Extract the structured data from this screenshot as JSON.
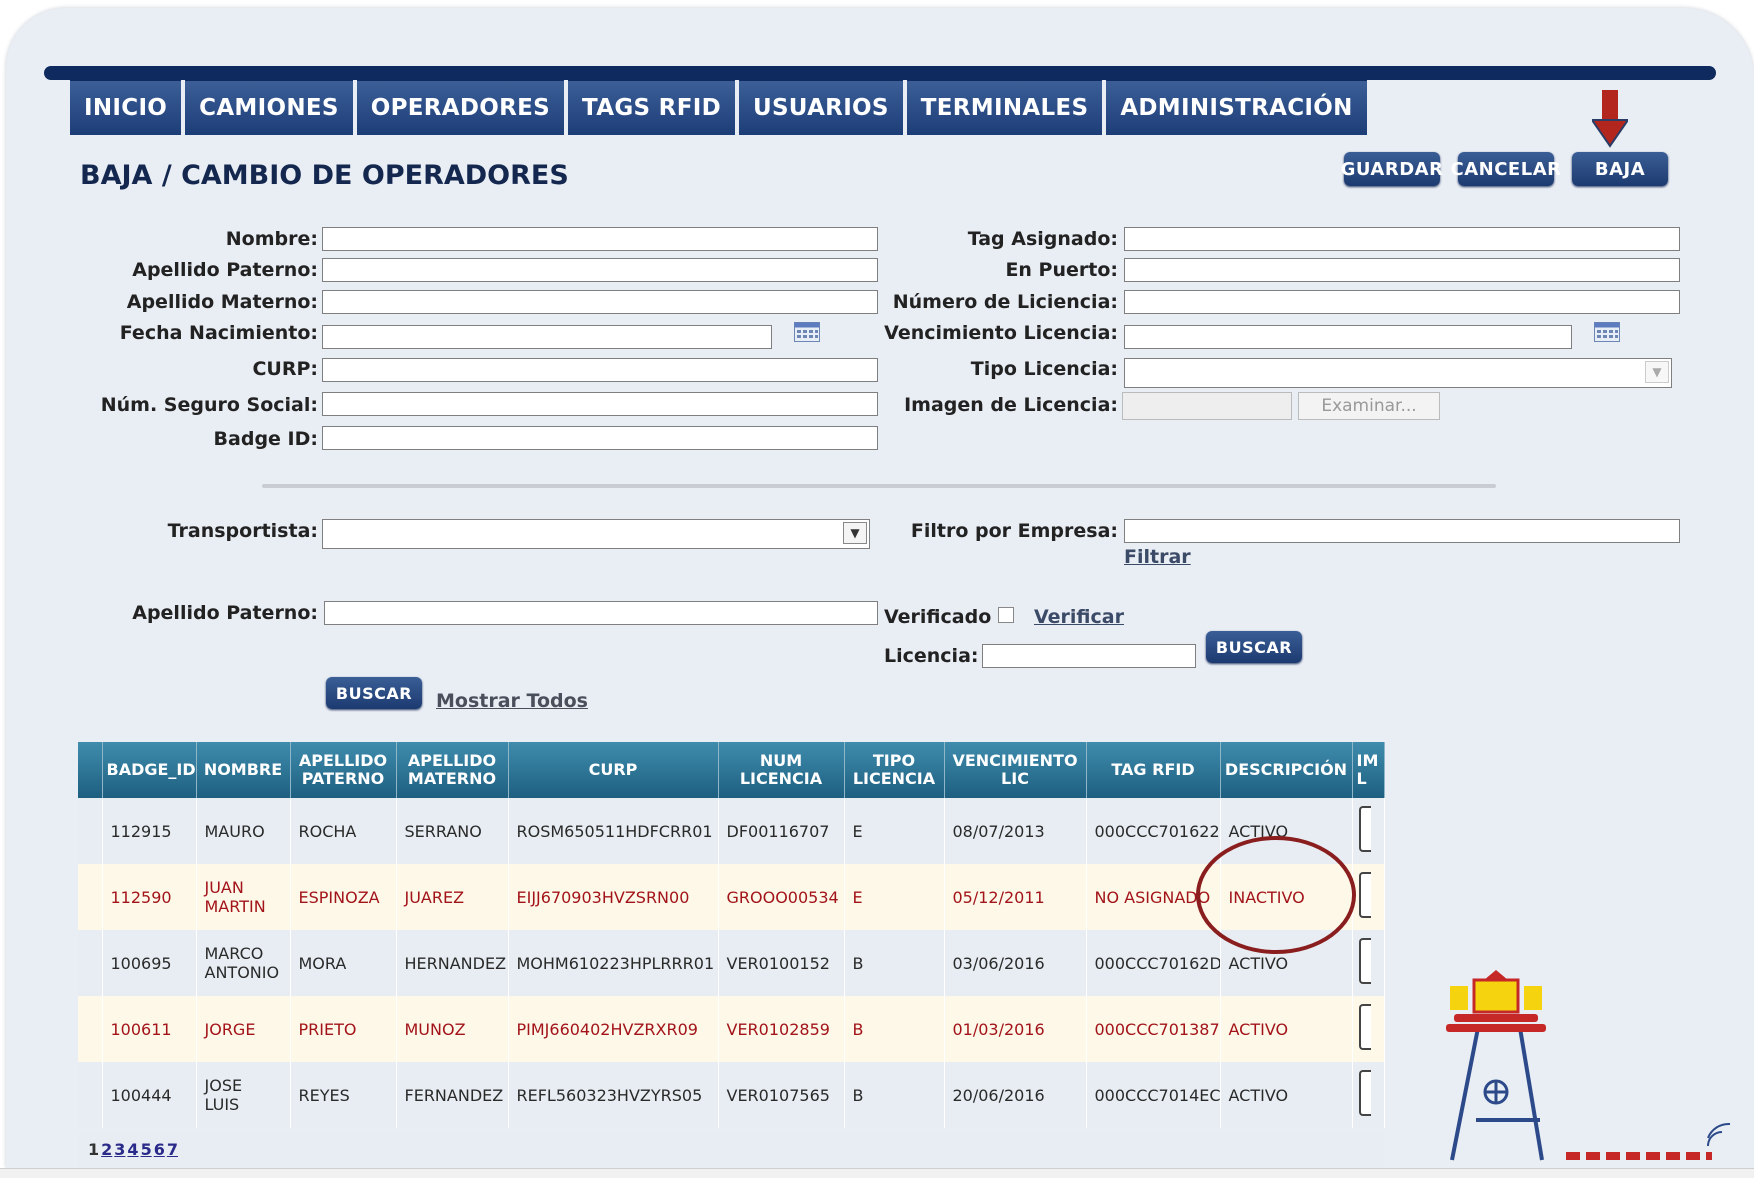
{
  "nav": {
    "items": [
      {
        "label": "INICIO"
      },
      {
        "label": "CAMIONES"
      },
      {
        "label": "OPERADORES"
      },
      {
        "label": "TAGS RFID"
      },
      {
        "label": "USUARIOS"
      },
      {
        "label": "TERMINALES"
      },
      {
        "label": "ADMINISTRACIÓN"
      }
    ]
  },
  "page_title": "BAJA / CAMBIO DE OPERADORES",
  "actions": {
    "save": "GUARDAR",
    "cancel": "CANCELAR",
    "delete": "BAJA"
  },
  "form": {
    "nombre": "Nombre:",
    "apellido_paterno": "Apellido Paterno:",
    "apellido_materno": "Apellido Materno:",
    "fecha_nacimiento": "Fecha Nacimiento:",
    "curp": "CURP:",
    "num_seguro_social": "Núm. Seguro Social:",
    "badge_id": "Badge ID:",
    "tag_asignado": "Tag Asignado:",
    "en_puerto": "En Puerto:",
    "numero_licencia": "Número de Liciencia:",
    "vencimiento_licencia": "Vencimiento Licencia:",
    "tipo_licencia": "Tipo Licencia:",
    "imagen_licencia": "Imagen de Licencia:",
    "examinar": "Examinar..."
  },
  "search": {
    "transportista": "Transportista:",
    "filtro_empresa": "Filtro por Empresa:",
    "filtrar": "Filtrar",
    "apellido_paterno": "Apellido Paterno:",
    "verificado": "Verificado",
    "verificar": "Verificar",
    "licencia": "Licencia:",
    "buscar": "BUSCAR",
    "buscar2": "BUSCAR",
    "mostrar_todos": "Mostrar Todos"
  },
  "table": {
    "headers": [
      {
        "l1": "BADGE_ID",
        "l2": ""
      },
      {
        "l1": "NOMBRE",
        "l2": ""
      },
      {
        "l1": "APELLIDO",
        "l2": "PATERNO"
      },
      {
        "l1": "APELLIDO",
        "l2": "MATERNO"
      },
      {
        "l1": "CURP",
        "l2": ""
      },
      {
        "l1": "NUM",
        "l2": "LICENCIA"
      },
      {
        "l1": "TIPO",
        "l2": "LICENCIA"
      },
      {
        "l1": "VENCIMIENTO",
        "l2": "LIC"
      },
      {
        "l1": "TAG RFID",
        "l2": ""
      },
      {
        "l1": "DESCRIPCIÓN",
        "l2": ""
      },
      {
        "l1": "IM",
        "l2": "L"
      }
    ],
    "rows": [
      {
        "badge": "112915",
        "nombre": "MAURO",
        "nombre2": "",
        "ap_pat": "ROCHA",
        "ap_mat": "SERRANO",
        "curp": "ROSM650511HDFCRR01",
        "num_lic": "DF00116707",
        "tipo": "E",
        "venc": "08/07/2013",
        "tag": "000CCC701622",
        "desc": "ACTIVO"
      },
      {
        "badge": "112590",
        "nombre": "JUAN",
        "nombre2": "MARTIN",
        "ap_pat": "ESPINOZA",
        "ap_mat": "JUAREZ",
        "curp": "EIJJ670903HVZSRN00",
        "num_lic": "GROOO00534",
        "tipo": "E",
        "venc": "05/12/2011",
        "tag": "NO ASIGNADO",
        "desc": "INACTIVO"
      },
      {
        "badge": "100695",
        "nombre": "MARCO",
        "nombre2": "ANTONIO",
        "ap_pat": "MORA",
        "ap_mat": "HERNANDEZ",
        "curp": "MOHM610223HPLRRR01",
        "num_lic": "VER0100152",
        "tipo": "B",
        "venc": "03/06/2016",
        "tag": "000CCC70162D",
        "desc": "ACTIVO"
      },
      {
        "badge": "100611",
        "nombre": "JORGE",
        "nombre2": "",
        "ap_pat": "PRIETO",
        "ap_mat": "MUNOZ",
        "curp": "PIMJ660402HVZRXR09",
        "num_lic": "VER0102859",
        "tipo": "B",
        "venc": "01/03/2016",
        "tag": "000CCC701387",
        "desc": "ACTIVO"
      },
      {
        "badge": "100444",
        "nombre": "JOSE",
        "nombre2": "LUIS",
        "ap_pat": "REYES",
        "ap_mat": "FERNANDEZ",
        "curp": "REFL560323HVZYRS05",
        "num_lic": "VER0107565",
        "tipo": "B",
        "venc": "20/06/2016",
        "tag": "000CCC7014EC",
        "desc": "ACTIVO"
      }
    ]
  },
  "pager": {
    "pages": [
      "1",
      "2",
      "3",
      "4",
      "5",
      "6",
      "7"
    ]
  }
}
